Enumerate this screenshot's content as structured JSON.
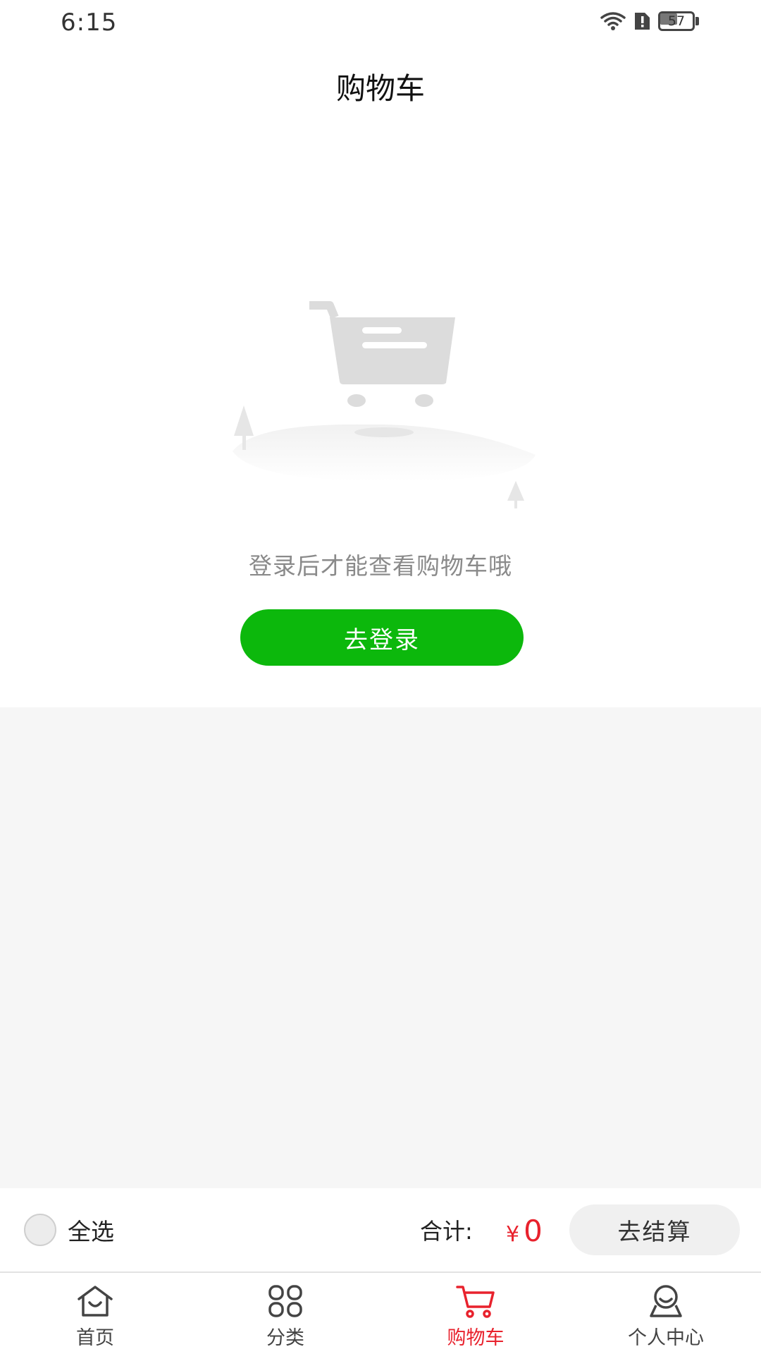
{
  "status_bar": {
    "time": "6:15",
    "battery_level": "57",
    "icons": [
      "wifi-icon",
      "sim-alert-icon",
      "battery-icon"
    ]
  },
  "header": {
    "title": "购物车"
  },
  "empty_state": {
    "illustration": "empty-cart-illustration",
    "message": "登录后才能查看购物车哦",
    "login_button_label": "去登录"
  },
  "cart_footer": {
    "select_all_label": "全选",
    "total_label": "合计:",
    "currency_symbol": "¥",
    "total_value": "0",
    "checkout_label": "去结算"
  },
  "tab_bar": {
    "items": [
      {
        "label": "首页",
        "icon": "home-icon",
        "active": false
      },
      {
        "label": "分类",
        "icon": "category-grid-icon",
        "active": false
      },
      {
        "label": "购物车",
        "icon": "cart-icon",
        "active": true
      },
      {
        "label": "个人中心",
        "icon": "user-icon",
        "active": false
      }
    ]
  },
  "colors": {
    "accent_green": "#0cb80c",
    "accent_red": "#e8222d",
    "background_gray": "#f6f6f6"
  }
}
